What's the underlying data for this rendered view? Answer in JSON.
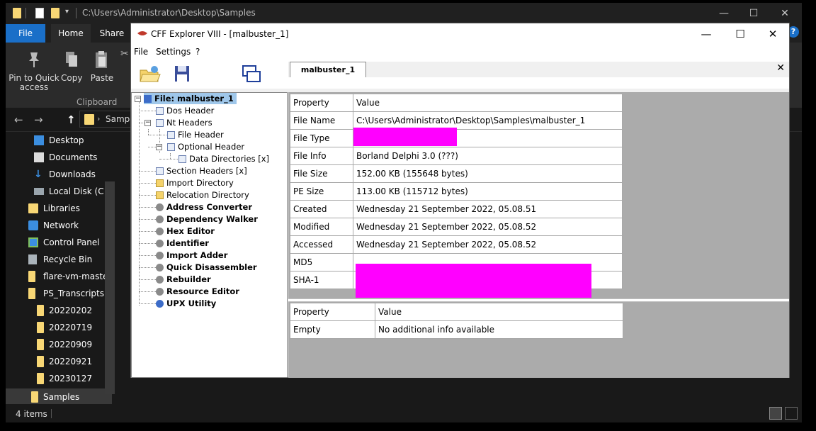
{
  "explorer": {
    "title_path": "C:\\Users\\Administrator\\Desktop\\Samples",
    "ribbon_tabs": [
      "File",
      "Home",
      "Share"
    ],
    "ribbon_buttons": {
      "pin": "Pin to Quick access",
      "copy": "Copy",
      "paste": "Paste"
    },
    "clipboard_group": "Clipboard",
    "address_text": "Samp",
    "nav_items": [
      {
        "label": "Desktop",
        "icon": "desktop-icon"
      },
      {
        "label": "Documents",
        "icon": "documents-icon"
      },
      {
        "label": "Downloads",
        "icon": "downloads-icon"
      },
      {
        "label": "Local Disk (C:)",
        "icon": "drive-icon"
      },
      {
        "label": "Libraries",
        "icon": "libraries-icon"
      },
      {
        "label": "Network",
        "icon": "network-icon"
      },
      {
        "label": "Control Panel",
        "icon": "control-panel-icon"
      },
      {
        "label": "Recycle Bin",
        "icon": "recycle-bin-icon"
      },
      {
        "label": "flare-vm-master",
        "icon": "folder-icon"
      },
      {
        "label": "PS_Transcripts",
        "icon": "folder-icon"
      },
      {
        "label": "20220202",
        "icon": "folder-icon"
      },
      {
        "label": "20220719",
        "icon": "folder-icon"
      },
      {
        "label": "20220909",
        "icon": "folder-icon"
      },
      {
        "label": "20220921",
        "icon": "folder-icon"
      },
      {
        "label": "20230127",
        "icon": "folder-icon"
      },
      {
        "label": "Samples",
        "icon": "folder-icon"
      }
    ],
    "status_items": "4 items"
  },
  "cff": {
    "title": "CFF Explorer VIII - [malbuster_1]",
    "menu": [
      "File",
      "Settings",
      "?"
    ],
    "tab_label": "malbuster_1",
    "tree": {
      "root": "File: malbuster_1",
      "dos_header": "Dos Header",
      "nt_headers": "Nt Headers",
      "file_header": "File Header",
      "optional_header": "Optional Header",
      "data_directories": "Data Directories [x]",
      "section_headers": "Section Headers [x]",
      "import_directory": "Import Directory",
      "relocation_directory": "Relocation Directory",
      "tools": [
        "Address Converter",
        "Dependency Walker",
        "Hex Editor",
        "Identifier",
        "Import Adder",
        "Quick Disassembler",
        "Rebuilder",
        "Resource Editor",
        "UPX Utility"
      ]
    },
    "top_grid": {
      "headers": [
        "Property",
        "Value"
      ],
      "rows": [
        [
          "File Name",
          "C:\\Users\\Administrator\\Desktop\\Samples\\malbuster_1"
        ],
        [
          "File Type",
          ""
        ],
        [
          "File Info",
          "Borland Delphi 3.0 (???)"
        ],
        [
          "File Size",
          "152.00 KB (155648 bytes)"
        ],
        [
          "PE Size",
          "113.00 KB (115712 bytes)"
        ],
        [
          "Created",
          "Wednesday 21 September 2022, 05.08.51"
        ],
        [
          "Modified",
          "Wednesday 21 September 2022, 05.08.52"
        ],
        [
          "Accessed",
          "Wednesday 21 September 2022, 05.08.52"
        ],
        [
          "MD5",
          ""
        ],
        [
          "SHA-1",
          ""
        ]
      ]
    },
    "bottom_grid": {
      "headers": [
        "Property",
        "Value"
      ],
      "rows": [
        [
          "Empty",
          "No additional info available"
        ]
      ]
    }
  },
  "colors": {
    "redaction": "#ff00ff",
    "selection": "#9fc7ea",
    "accent": "#1a6fc8"
  }
}
